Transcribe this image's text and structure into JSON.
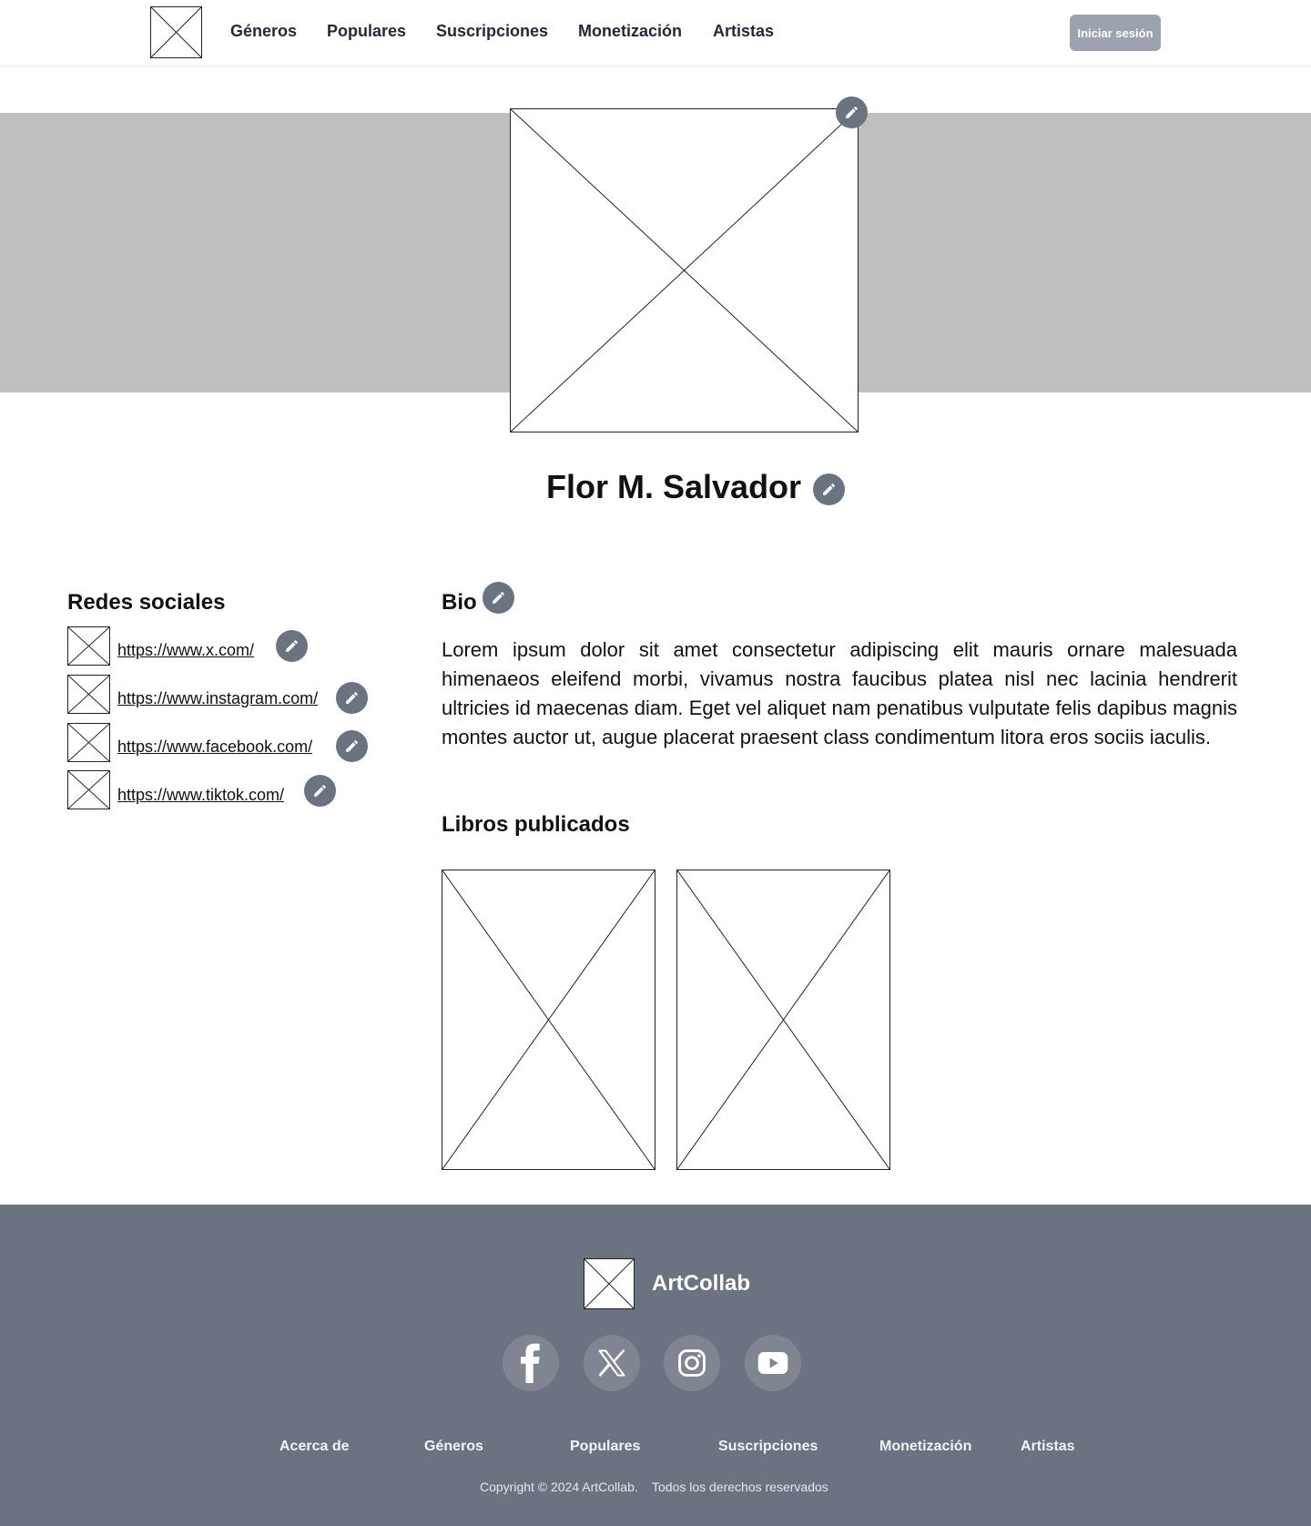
{
  "header": {
    "nav": [
      "Géneros",
      "Populares",
      "Suscripciones",
      "Monetización",
      "Artistas"
    ],
    "login_label": "Iniciar sesión"
  },
  "profile": {
    "name": "Flor M. Salvador"
  },
  "social": {
    "title": "Redes sociales",
    "links": [
      "https://www.x.com/",
      "https://www.instagram.com/",
      "https://www.facebook.com/",
      "https://www.tiktok.com/"
    ]
  },
  "bio": {
    "title": "Bio",
    "text": "Lorem ipsum dolor sit amet consectetur adipiscing elit mauris ornare malesuada himenaeos eleifend morbi, vivamus nostra faucibus platea nisl nec lacinia hendrerit ultricies id maecenas diam. Eget vel aliquet nam penatibus vulputate felis dapibus magnis montes auctor ut, augue placerat praesent class condimentum litora eros sociis iaculis."
  },
  "books": {
    "title": "Libros publicados"
  },
  "footer": {
    "brand": "ArtCollab",
    "social_icons": [
      "facebook-icon",
      "x-icon",
      "instagram-icon",
      "youtube-icon"
    ],
    "links": [
      "Acerca de",
      "Géneros",
      "Populares",
      "Suscripciones",
      "Monetización",
      "Artistas"
    ],
    "copyright": "Copyright © 2024 ArtCollab.",
    "rights": "Todos los derechos reservados"
  },
  "colors": {
    "banner": "#bfbfbf",
    "footer": "#6b7280",
    "edit_button": "#6b7280",
    "login_button": "#9ca3af"
  }
}
